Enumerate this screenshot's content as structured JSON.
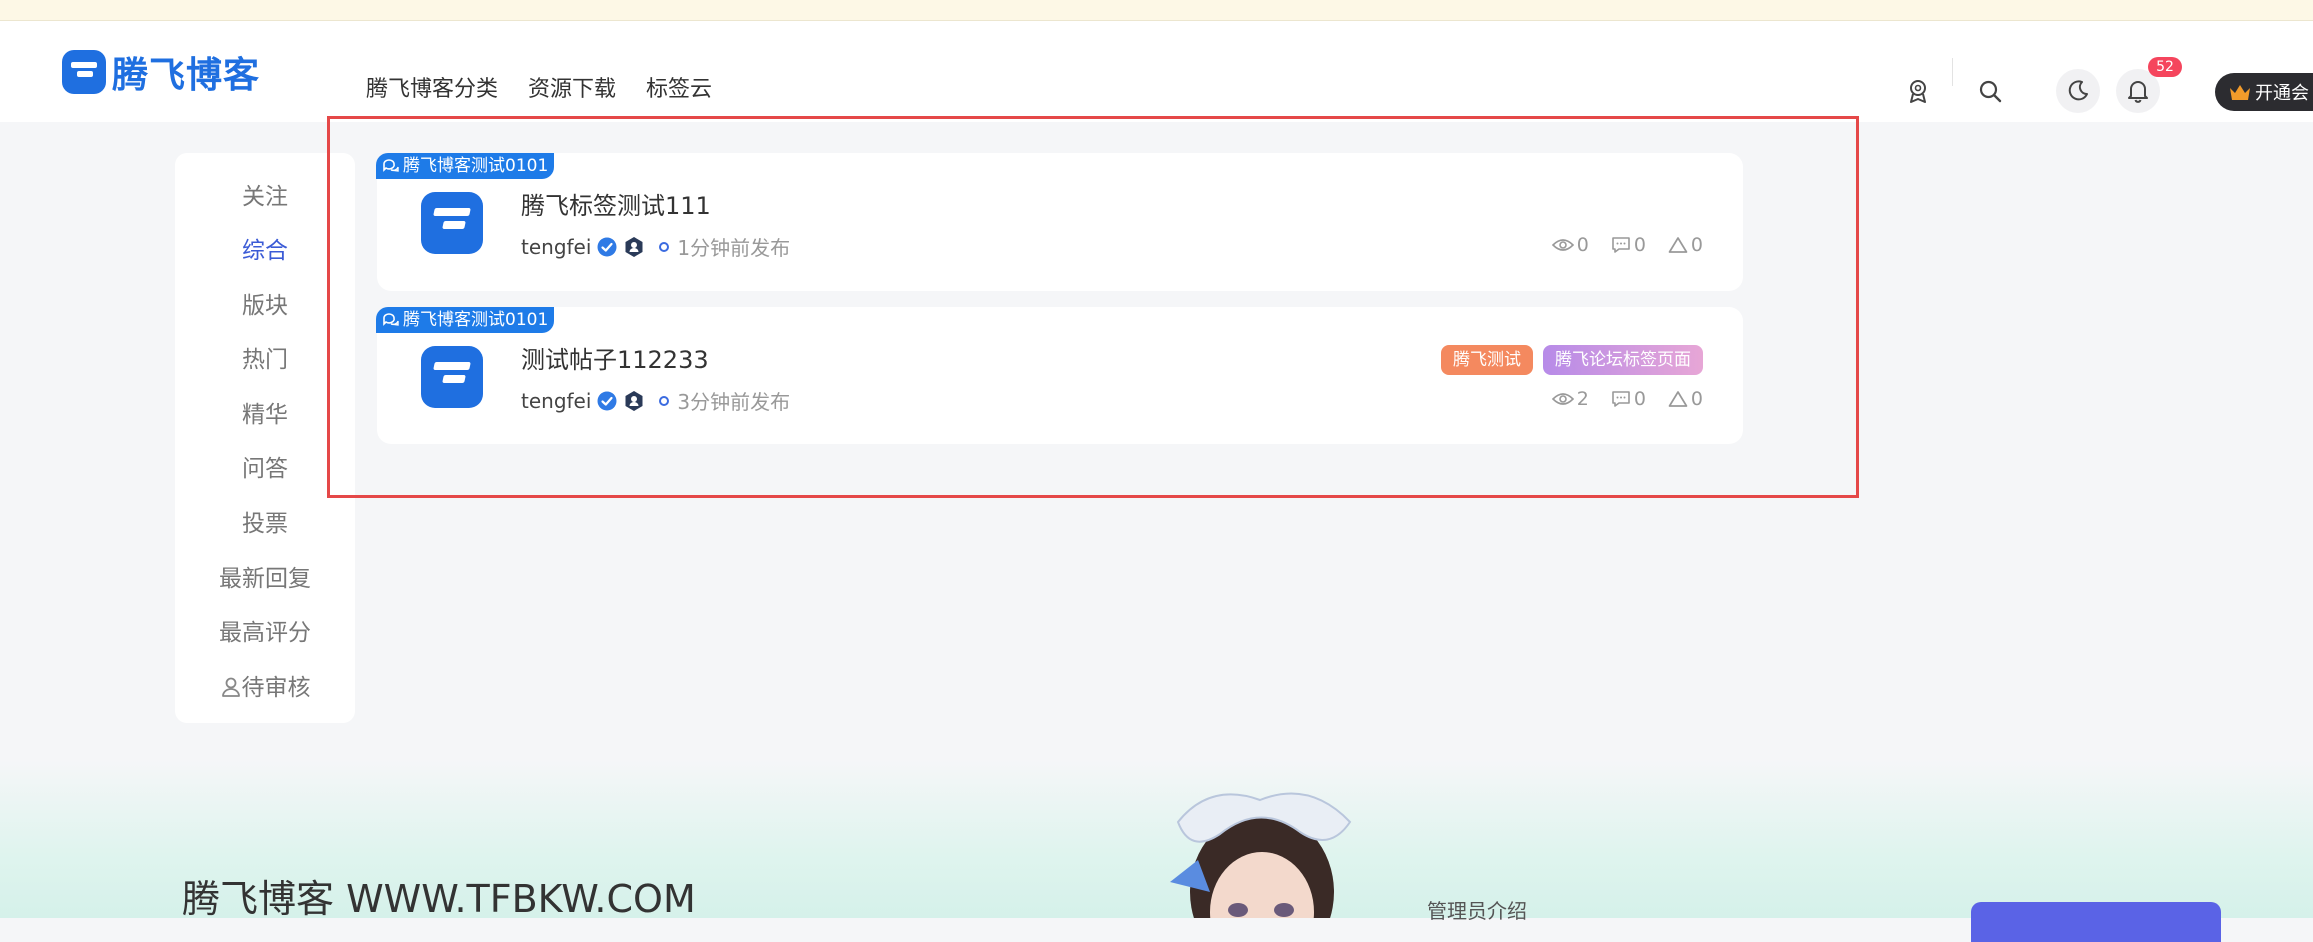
{
  "brand": {
    "name": "腾飞博客"
  },
  "nav": {
    "items": [
      "腾飞博客分类",
      "资源下载",
      "标签云"
    ]
  },
  "header": {
    "notification_count": "52",
    "vip_label": "开通会",
    "icons": [
      "award-icon",
      "search-icon",
      "moon-icon",
      "bell-icon",
      "crown-icon"
    ]
  },
  "sidebar": {
    "items": [
      "关注",
      "综合",
      "版块",
      "热门",
      "精华",
      "问答",
      "投票",
      "最新回复",
      "最高评分",
      "待审核"
    ],
    "active_index": 1
  },
  "posts": [
    {
      "board_tag": "腾飞博客测试0101",
      "title": "腾飞标签测试111",
      "author": "tengfei",
      "time": "1分钟前发布",
      "views": "0",
      "comments": "0",
      "likes": "0",
      "tags": []
    },
    {
      "board_tag": "腾飞博客测试0101",
      "title": "测试帖子112233",
      "author": "tengfei",
      "time": "3分钟前发布",
      "views": "2",
      "comments": "0",
      "likes": "0",
      "tags": [
        "腾飞测试",
        "腾飞论坛标签页面"
      ]
    }
  ],
  "footer": {
    "site_title": "腾飞博客 WWW.TFBKW.COM",
    "admin_intro": "管理员介绍"
  },
  "colors": {
    "accent": "#1f6fe0",
    "active_nav": "#3b5bd6",
    "highlight_box": "#e54848",
    "badge": "#f5455d",
    "tag_orange": "#f4895f",
    "tag_purple_start": "#b78be8",
    "tag_purple_end": "#e7a6d6"
  }
}
